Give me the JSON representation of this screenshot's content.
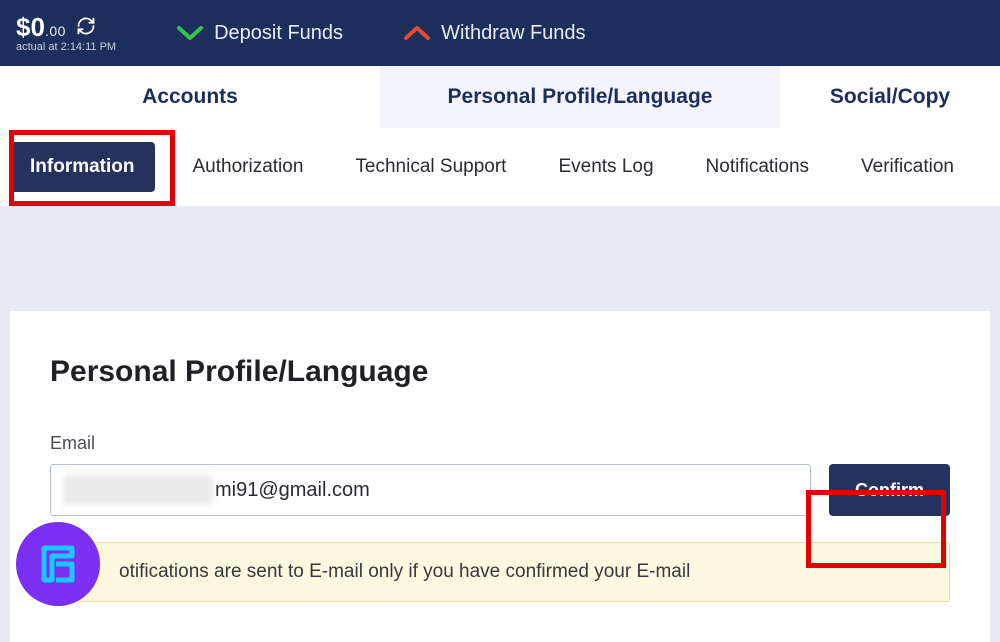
{
  "topbar": {
    "balance_currency_symbol": "$",
    "balance_whole": "0",
    "balance_cents": ".00",
    "balance_subtext": "actual at 2:14:11 PM",
    "deposit_label": "Deposit Funds",
    "withdraw_label": "Withdraw Funds"
  },
  "primary_tabs": {
    "accounts": "Accounts",
    "profile": "Personal Profile/Language",
    "social": "Social/Copy "
  },
  "subtabs": {
    "information": "Information",
    "authorization": "Authorization",
    "technical_support": "Technical Support",
    "events_log": "Events Log",
    "notifications": "Notifications",
    "verification": "Verification"
  },
  "card": {
    "heading": "Personal Profile/Language",
    "email_label": "Email",
    "email_visible_value": "mi91@gmail.com",
    "confirm_label": "Confirm",
    "notice_text": "otifications are sent to E-mail only if you have confirmed your E-mail"
  },
  "colors": {
    "topbar_bg": "#1c2e5b",
    "accent_green": "#33c24d",
    "accent_red_orange": "#e34a33",
    "highlight_red": "#e40000",
    "pill_bg": "#25325e",
    "confirm_bg": "#24325f",
    "logo_bg": "#7b2ff2",
    "notice_bg": "#fdf8e0"
  }
}
